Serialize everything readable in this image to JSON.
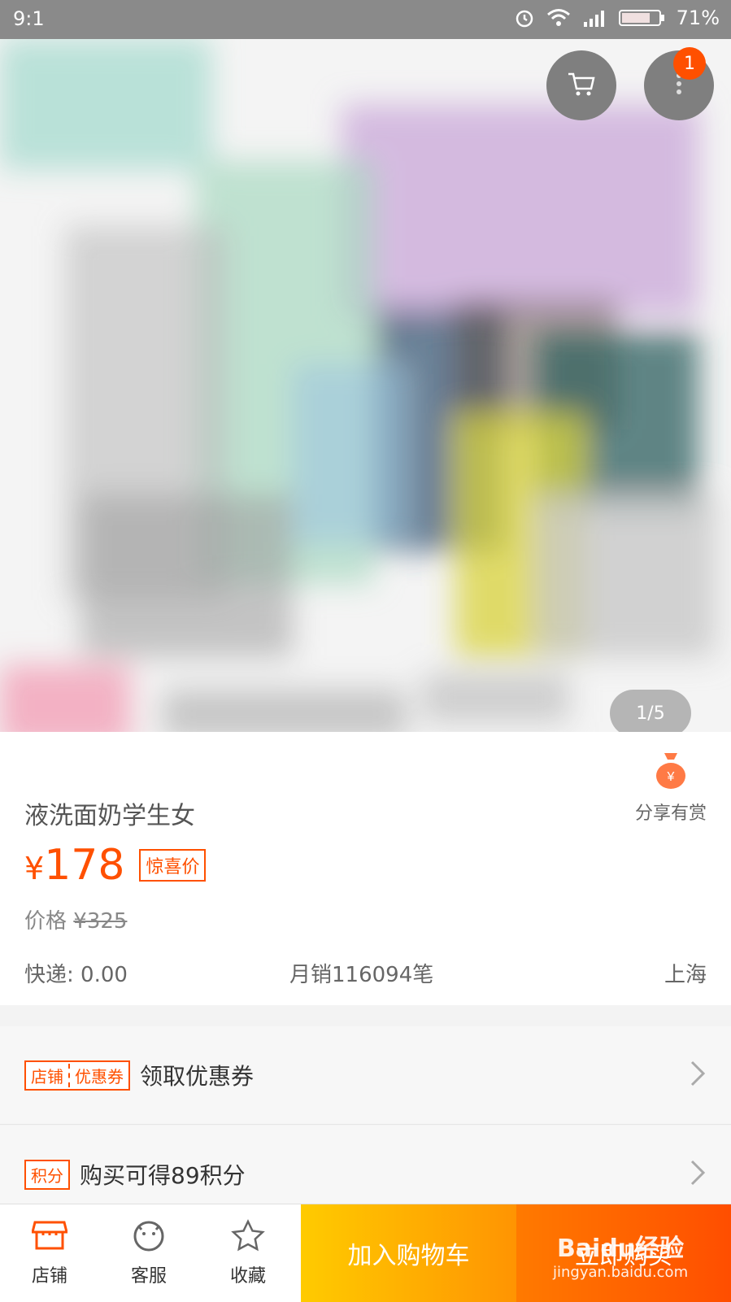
{
  "status_bar": {
    "time": "9:1",
    "battery": "71%"
  },
  "hero": {
    "pager": "1/5",
    "cart_badge": "1"
  },
  "product": {
    "title": "液洗面奶学生女",
    "share_label": "分享有赏",
    "currency": "¥",
    "price": "178",
    "price_tag": "惊喜价",
    "orig_label": "价格",
    "orig_price": "¥325",
    "shipping": "快递: 0.00",
    "sales": "月销116094笔",
    "location": "上海"
  },
  "coupon_row": {
    "tag_a": "店铺",
    "tag_b": "优惠券",
    "text": "领取优惠券"
  },
  "points_row": {
    "tag": "积分",
    "text": "购买可得89积分"
  },
  "bottom_bar": {
    "shop": "店铺",
    "service": "客服",
    "favorite": "收藏",
    "add_to_cart": "加入购物车",
    "buy_now": "立即购买"
  },
  "watermark": {
    "line1": "Baidu经验",
    "line2": "jingyan.baidu.com"
  },
  "colors": {
    "accent": "#ff5000",
    "cart_gradient": "#ffcb00",
    "buy_gradient": "#ff4e00"
  },
  "icons": [
    "cart-icon",
    "more-icon",
    "money-bag-icon",
    "shop-icon",
    "service-icon",
    "star-icon",
    "chevron-right-icon",
    "alarm-icon",
    "wifi-icon",
    "signal-icon",
    "battery-icon"
  ]
}
